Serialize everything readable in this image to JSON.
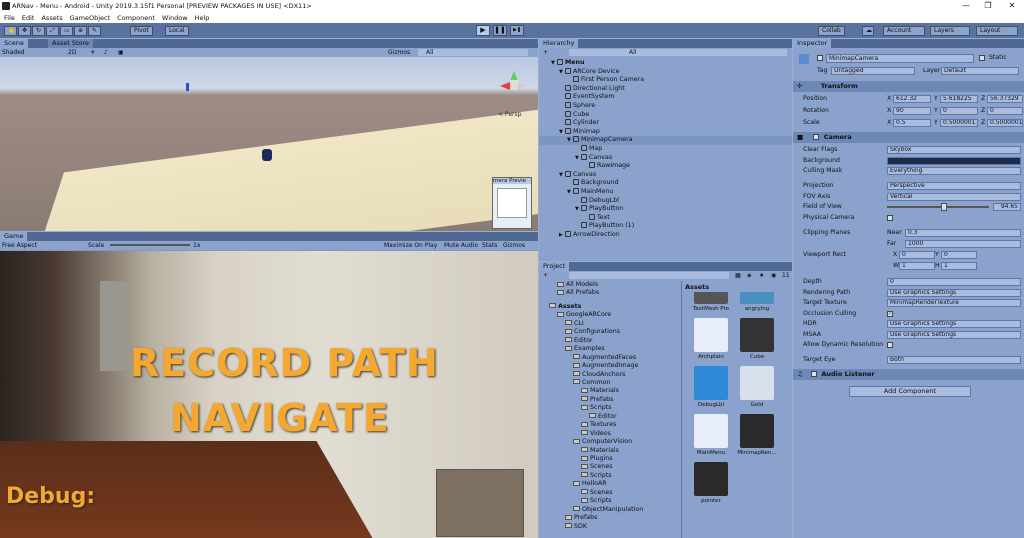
{
  "window": {
    "title": "ARNav - Menu - Android - Unity 2019.3.15f1 Personal [PREVIEW PACKAGES IN USE] <DX11>",
    "minimize": "—",
    "maximize": "❐",
    "close": "✕"
  },
  "menu": [
    "File",
    "Edit",
    "Assets",
    "GameObject",
    "Component",
    "Window",
    "Help"
  ],
  "toolbar": {
    "pivot": "Pivot",
    "local": "Local",
    "collab": "Collab",
    "account": "Account",
    "layers": "Layers",
    "layout": "Layout",
    "play": "▶",
    "pause": "❚❚",
    "step": "▶❚"
  },
  "scene": {
    "tab_scene": "Scene",
    "tab_asset_store": "Asset Store",
    "shading": "Shaded",
    "mode_2d": "2D",
    "gizmos": "Gizmos",
    "search": "All",
    "persp": "< Persp",
    "preview": "mera Previe"
  },
  "game": {
    "tab": "Game",
    "aspect": "Free Aspect",
    "scale_label": "Scale",
    "scale_value": "1x",
    "maximize": "Maximize On Play",
    "mute": "Mute Audio",
    "stats": "Stats",
    "gizmos": "Gizmos",
    "line1": "RECORD PATH",
    "line2": "NAVIGATE",
    "debug": "Debug:"
  },
  "hierarchy": {
    "tab": "Hierarchy",
    "create": "+",
    "search": "All",
    "items": [
      {
        "label": "Menu",
        "depth": 0,
        "arrow": "▼"
      },
      {
        "label": "ARCore Device",
        "depth": 1,
        "arrow": "▼"
      },
      {
        "label": "First Person Camera",
        "depth": 2,
        "arrow": ""
      },
      {
        "label": "Directional Light",
        "depth": 1,
        "arrow": ""
      },
      {
        "label": "EventSystem",
        "depth": 1,
        "arrow": ""
      },
      {
        "label": "Sphere",
        "depth": 1,
        "arrow": ""
      },
      {
        "label": "Cube",
        "depth": 1,
        "arrow": ""
      },
      {
        "label": "Cylinder",
        "depth": 1,
        "arrow": ""
      },
      {
        "label": "Minimap",
        "depth": 1,
        "arrow": "▼"
      },
      {
        "label": "MinimapCamera",
        "depth": 2,
        "arrow": "▼"
      },
      {
        "label": "Map",
        "depth": 3,
        "arrow": ""
      },
      {
        "label": "Canvas",
        "depth": 3,
        "arrow": "▼"
      },
      {
        "label": "RawImage",
        "depth": 4,
        "arrow": ""
      },
      {
        "label": "Canvas",
        "depth": 1,
        "arrow": "▼"
      },
      {
        "label": "Background",
        "depth": 2,
        "arrow": ""
      },
      {
        "label": "MainMenu",
        "depth": 2,
        "arrow": "▼"
      },
      {
        "label": "DebugLbl",
        "depth": 3,
        "arrow": ""
      },
      {
        "label": "PlayButton",
        "depth": 3,
        "arrow": "▼"
      },
      {
        "label": "Text",
        "depth": 4,
        "arrow": ""
      },
      {
        "label": "PlayButton (1)",
        "depth": 3,
        "arrow": ""
      },
      {
        "label": "ArrowDirection",
        "depth": 1,
        "arrow": "▶"
      }
    ]
  },
  "project": {
    "tab": "Project",
    "create": "+",
    "count": "11",
    "assets_header": "Assets",
    "tree": [
      {
        "label": "All Models",
        "depth": 1
      },
      {
        "label": "All Prefabs",
        "depth": 1
      },
      {
        "label": "Assets",
        "depth": 0,
        "bold": true
      },
      {
        "label": "GoogleARCore",
        "depth": 1
      },
      {
        "label": "CLI",
        "depth": 2
      },
      {
        "label": "Configurations",
        "depth": 2
      },
      {
        "label": "Editor",
        "depth": 2
      },
      {
        "label": "Examples",
        "depth": 2
      },
      {
        "label": "AugmentedFaces",
        "depth": 3
      },
      {
        "label": "AugmentedImage",
        "depth": 3
      },
      {
        "label": "CloudAnchors",
        "depth": 3
      },
      {
        "label": "Common",
        "depth": 3
      },
      {
        "label": "Materials",
        "depth": 4
      },
      {
        "label": "Prefabs",
        "depth": 4
      },
      {
        "label": "Scripts",
        "depth": 4
      },
      {
        "label": "Editor",
        "depth": 5
      },
      {
        "label": "Textures",
        "depth": 4
      },
      {
        "label": "Videos",
        "depth": 4
      },
      {
        "label": "ComputerVision",
        "depth": 3
      },
      {
        "label": "Materials",
        "depth": 4
      },
      {
        "label": "Plugins",
        "depth": 4
      },
      {
        "label": "Scenes",
        "depth": 4
      },
      {
        "label": "Scripts",
        "depth": 4
      },
      {
        "label": "HelloAR",
        "depth": 3
      },
      {
        "label": "Scenes",
        "depth": 4
      },
      {
        "label": "Scripts",
        "depth": 4
      },
      {
        "label": "ObjectManipulation",
        "depth": 3
      },
      {
        "label": "Prefabs",
        "depth": 2
      },
      {
        "label": "SDK",
        "depth": 2
      }
    ],
    "assets": [
      {
        "label": "TextMesh Pro",
        "color": "#555"
      },
      {
        "label": "angrylng",
        "color": "#4a8fc0"
      },
      {
        "label": "Archplain",
        "color": "#e8eef8"
      },
      {
        "label": "Cube",
        "color": "#333"
      },
      {
        "label": "DebugLbl",
        "color": "#2d89d8"
      },
      {
        "label": "Gold",
        "color": "#d8e0ee"
      },
      {
        "label": "MainMenu",
        "color": "#e8eef8"
      },
      {
        "label": "MinimapRen...",
        "color": "#2a2a2a"
      },
      {
        "label": "pointer",
        "color": "#2a2a2a"
      }
    ]
  },
  "inspector": {
    "tab": "Inspector",
    "object_name": "MinimapCamera",
    "static": "Static",
    "tag_label": "Tag",
    "tag": "Untagged",
    "layer_label": "Layer",
    "layer": "Default",
    "transform": {
      "title": "Transform",
      "position": "Position",
      "rotation": "Rotation",
      "scale": "Scale",
      "px": "612.32",
      "py": "5.618225",
      "pz": "56.37329",
      "rx": "90",
      "ry": "0",
      "rz": "0",
      "sx": "0.5",
      "sy": "0.5000001",
      "sz": "0.5000001"
    },
    "camera": {
      "title": "Camera",
      "clear_flags": "Clear Flags",
      "clear_flags_v": "Skybox",
      "background": "Background",
      "culling_mask": "Culling Mask",
      "culling_mask_v": "Everything",
      "projection": "Projection",
      "projection_v": "Perspective",
      "fov_axis": "FOV Axis",
      "fov_axis_v": "Vertical",
      "fov": "Field of View",
      "fov_v": "94.65",
      "physical": "Physical Camera",
      "clipping": "Clipping Planes",
      "near": "Near",
      "near_v": "0.3",
      "far": "Far",
      "far_v": "1000",
      "viewport": "Viewport Rect",
      "vx": "0",
      "vy": "0",
      "vw": "1",
      "vh": "1",
      "depth": "Depth",
      "depth_v": "0",
      "rendering_path": "Rendering Path",
      "rendering_path_v": "Use Graphics Settings",
      "target_texture": "Target Texture",
      "target_texture_v": "MinimapRenderTexture",
      "occlusion": "Occlusion Culling",
      "hdr": "HDR",
      "hdr_v": "Use Graphics Settings",
      "msaa": "MSAA",
      "msaa_v": "Use Graphics Settings",
      "dyn_res": "Allow Dynamic Resolution",
      "target_eye": "Target Eye",
      "target_eye_v": "Both"
    },
    "audio": "Audio Listener",
    "add_component": "Add Component",
    "x": "X",
    "y": "Y",
    "z": "Z",
    "w": "W",
    "h": "H"
  }
}
